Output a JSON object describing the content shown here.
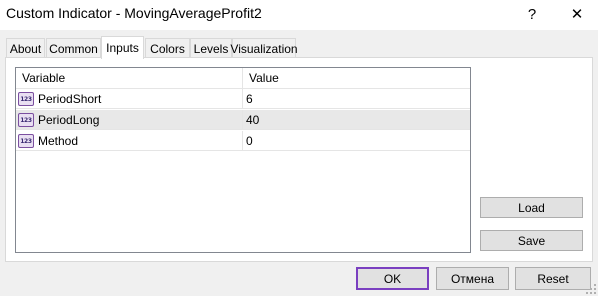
{
  "window": {
    "title": "Custom Indicator - MovingAverageProfit2",
    "help_glyph": "?",
    "close_glyph": "✕"
  },
  "tabs": [
    {
      "label": "About",
      "active": false
    },
    {
      "label": "Common",
      "active": false
    },
    {
      "label": "Inputs",
      "active": true
    },
    {
      "label": "Colors",
      "active": false
    },
    {
      "label": "Levels",
      "active": false
    },
    {
      "label": "Visualization",
      "active": false
    }
  ],
  "inputs_table": {
    "columns": [
      "Variable",
      "Value"
    ],
    "type_icon_text": "123",
    "rows": [
      {
        "variable": "PeriodShort",
        "value": "6",
        "selected": false
      },
      {
        "variable": "PeriodLong",
        "value": "40",
        "selected": true
      },
      {
        "variable": "Method",
        "value": "0",
        "selected": false
      }
    ]
  },
  "side_buttons": {
    "load": "Load",
    "save": "Save"
  },
  "footer_buttons": {
    "ok": "OK",
    "cancel": "Отмена",
    "reset": "Reset"
  },
  "colors": {
    "selected_row": "#e8e8e8",
    "default_button_border": "#7a3fc0",
    "type_icon_fill": "#e9dff2"
  },
  "icons": {
    "type": "integer-type-icon",
    "help": "help-icon",
    "close": "close-icon"
  }
}
